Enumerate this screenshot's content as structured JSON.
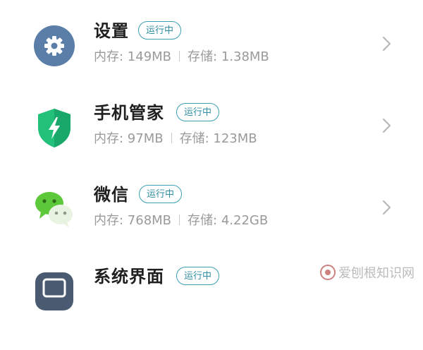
{
  "apps": [
    {
      "name": "设置",
      "status": "运行中",
      "memory": "内存: 149MB",
      "storage": "存储: 1.38MB",
      "icon": "gear-icon"
    },
    {
      "name": "手机管家",
      "status": "运行中",
      "memory": "内存: 97MB",
      "storage": "存储: 123MB",
      "icon": "shield-bolt-icon"
    },
    {
      "name": "微信",
      "status": "运行中",
      "memory": "内存: 768MB",
      "storage": "存储: 4.22GB",
      "icon": "wechat-icon"
    },
    {
      "name": "系统界面",
      "status": "运行中",
      "icon": "system-ui-icon"
    }
  ],
  "watermark": {
    "text": "爱刨根知识网"
  },
  "colors": {
    "badge": "#2f8ea3",
    "settings_icon": "#5a7ea8",
    "manager_icon": "#23c07a",
    "wechat_icon": "#5dc83a",
    "system_icon": "#4a5a70"
  }
}
